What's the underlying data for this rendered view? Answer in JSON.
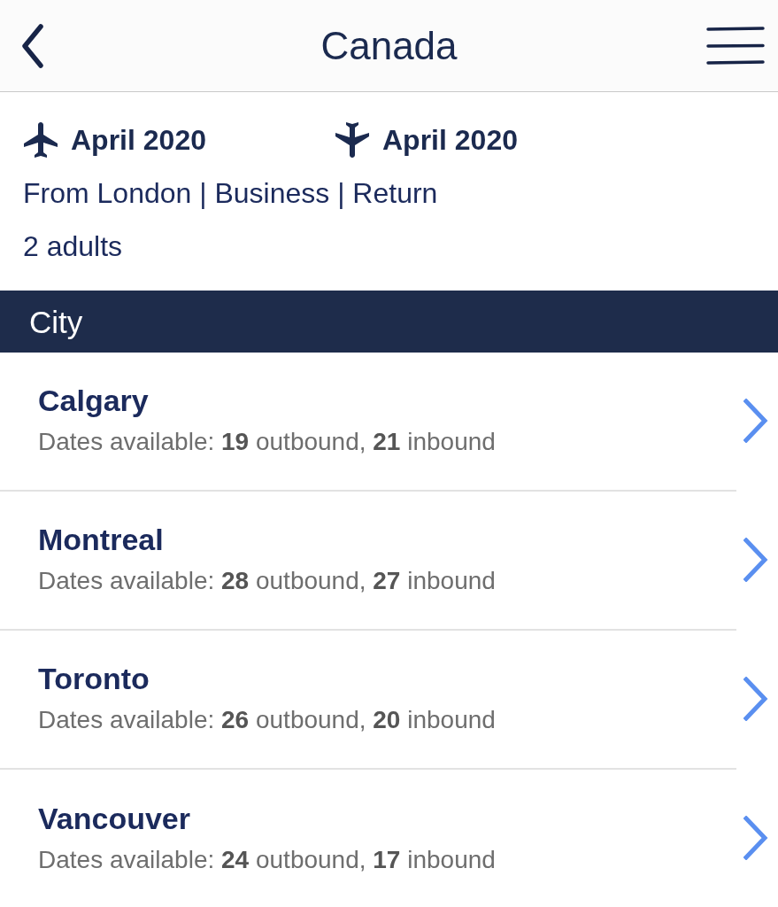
{
  "header": {
    "title": "Canada"
  },
  "trip": {
    "flights": [
      {
        "kind": "outbound",
        "date": "April 2020"
      },
      {
        "kind": "inbound",
        "date": "April 2020"
      }
    ],
    "summary": "From London | Business | Return",
    "passengers": "2 adults"
  },
  "section_header": {
    "label": "City"
  },
  "cities": [
    {
      "name": "Calgary",
      "availability": "Dates available: **19** outbound, **21** inbound"
    },
    {
      "name": "Montreal",
      "availability": "Dates available: **28** outbound, **27** inbound"
    },
    {
      "name": "Toronto",
      "availability": "Dates available: **26** outbound, **20** inbound"
    },
    {
      "name": "Vancouver",
      "availability": "Dates available: **24** outbound, **17** inbound"
    }
  ]
}
